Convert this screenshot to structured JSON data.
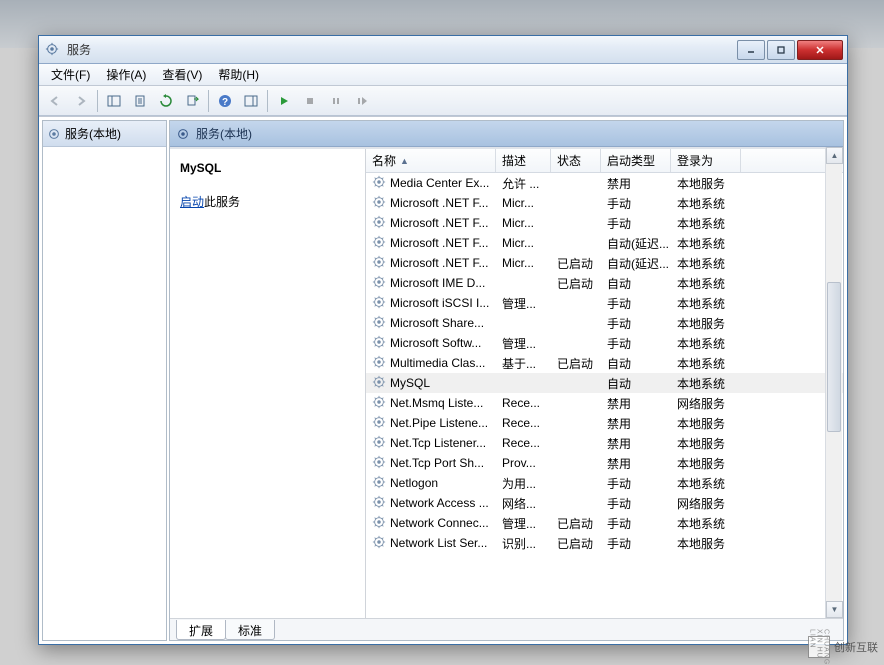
{
  "window": {
    "title": "服务"
  },
  "menu": {
    "file": "文件(F)",
    "action": "操作(A)",
    "view": "查看(V)",
    "help": "帮助(H)"
  },
  "sidebar": {
    "label": "服务(本地)"
  },
  "main_header": {
    "label": "服务(本地)"
  },
  "detail": {
    "selected_name": "MySQL",
    "start_link": "启动",
    "start_suffix": "此服务"
  },
  "columns": {
    "name": "名称",
    "desc": "描述",
    "status": "状态",
    "start_type": "启动类型",
    "login_as": "登录为"
  },
  "rows": [
    {
      "name": "Media Center Ex...",
      "desc": "允许 ...",
      "status": "",
      "start": "禁用",
      "login": "本地服务"
    },
    {
      "name": "Microsoft .NET F...",
      "desc": "Micr...",
      "status": "",
      "start": "手动",
      "login": "本地系统"
    },
    {
      "name": "Microsoft .NET F...",
      "desc": "Micr...",
      "status": "",
      "start": "手动",
      "login": "本地系统"
    },
    {
      "name": "Microsoft .NET F...",
      "desc": "Micr...",
      "status": "",
      "start": "自动(延迟...",
      "login": "本地系统"
    },
    {
      "name": "Microsoft .NET F...",
      "desc": "Micr...",
      "status": "已启动",
      "start": "自动(延迟...",
      "login": "本地系统"
    },
    {
      "name": "Microsoft IME D...",
      "desc": "",
      "status": "已启动",
      "start": "自动",
      "login": "本地系统"
    },
    {
      "name": "Microsoft iSCSI I...",
      "desc": "管理...",
      "status": "",
      "start": "手动",
      "login": "本地系统"
    },
    {
      "name": "Microsoft Share...",
      "desc": "",
      "status": "",
      "start": "手动",
      "login": "本地服务"
    },
    {
      "name": "Microsoft Softw...",
      "desc": "管理...",
      "status": "",
      "start": "手动",
      "login": "本地系统"
    },
    {
      "name": "Multimedia Clas...",
      "desc": "基于...",
      "status": "已启动",
      "start": "自动",
      "login": "本地系统"
    },
    {
      "name": "MySQL",
      "desc": "",
      "status": "",
      "start": "自动",
      "login": "本地系统",
      "selected": true
    },
    {
      "name": "Net.Msmq Liste...",
      "desc": "Rece...",
      "status": "",
      "start": "禁用",
      "login": "网络服务"
    },
    {
      "name": "Net.Pipe Listene...",
      "desc": "Rece...",
      "status": "",
      "start": "禁用",
      "login": "本地服务"
    },
    {
      "name": "Net.Tcp Listener...",
      "desc": "Rece...",
      "status": "",
      "start": "禁用",
      "login": "本地服务"
    },
    {
      "name": "Net.Tcp Port Sh...",
      "desc": "Prov...",
      "status": "",
      "start": "禁用",
      "login": "本地服务"
    },
    {
      "name": "Netlogon",
      "desc": "为用...",
      "status": "",
      "start": "手动",
      "login": "本地系统"
    },
    {
      "name": "Network Access ...",
      "desc": "网络...",
      "status": "",
      "start": "手动",
      "login": "网络服务"
    },
    {
      "name": "Network Connec...",
      "desc": "管理...",
      "status": "已启动",
      "start": "手动",
      "login": "本地系统"
    },
    {
      "name": "Network List Ser...",
      "desc": "识别...",
      "status": "已启动",
      "start": "手动",
      "login": "本地服务"
    }
  ],
  "tabs": {
    "extended": "扩展",
    "standard": "标准"
  },
  "watermark": {
    "brand": "创新互联",
    "side": "CHUANG XIN HU LIAN"
  }
}
